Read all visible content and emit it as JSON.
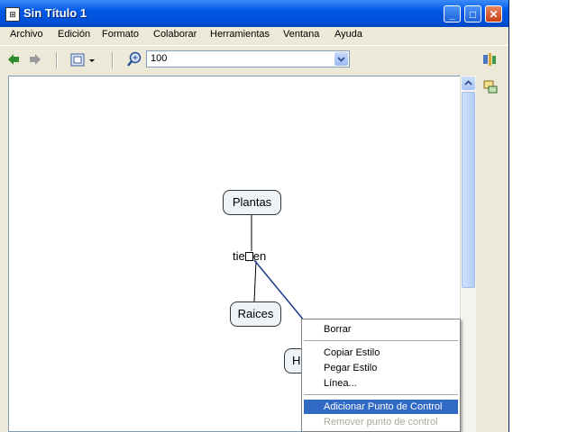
{
  "window": {
    "title": "Sin Título 1",
    "controls": {
      "minimize": "_",
      "maximize": "□",
      "close": "✕"
    }
  },
  "menubar": [
    "Archivo",
    "Edición",
    "Formato",
    "Colaborar",
    "Herramientas",
    "Ventana",
    "Ayuda"
  ],
  "toolbar": {
    "zoom_value": "100",
    "icons": [
      "back-arrow-icon",
      "forward-arrow-icon",
      "view-selector-icon",
      "zoom-icon",
      "style-palette-icon"
    ]
  },
  "concept_map": {
    "concepts": [
      "Plantas",
      "Raices",
      "H"
    ],
    "linking_phrase": "tie",
    "linking_phrase_suffix": "en"
  },
  "context_menu": {
    "items": [
      "Borrar",
      "Copiar Estilo",
      "Pegar Estilo",
      "Línea...",
      "Adicionar Punto de Control",
      "Remover punto de control"
    ],
    "highlighted": "Adicionar Punto de Control",
    "disabled": [
      "Remover punto de control"
    ]
  },
  "colors": {
    "title_bar": "#0058e6",
    "highlight": "#316ac5",
    "link_line": "#1f3a8a"
  }
}
